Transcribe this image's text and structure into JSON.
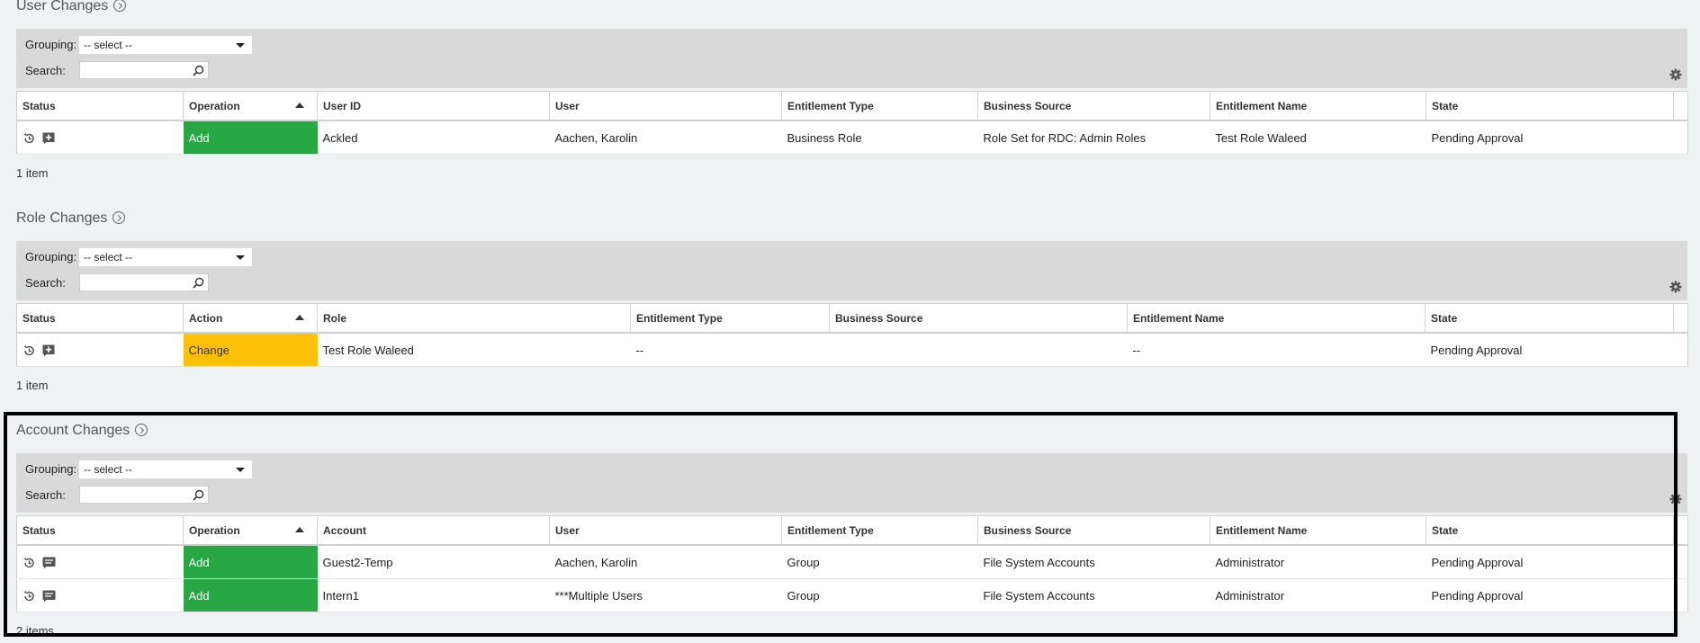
{
  "common": {
    "grouping_label": "Grouping:",
    "search_label": "Search:",
    "select_placeholder": "-- select --"
  },
  "user_changes": {
    "title": "User Changes",
    "columns": [
      "Status",
      "Operation",
      "User ID",
      "User",
      "Entitlement Type",
      "Business Source",
      "Entitlement Name",
      "State"
    ],
    "rows": [
      {
        "operation": "Add",
        "user_id": "Ackled",
        "user": "Aachen, Karolin",
        "entitlement_type": "Business Role",
        "business_source": "Role Set for RDC: Admin Roles",
        "entitlement_name": "Test Role Waleed",
        "state": "Pending Approval"
      }
    ],
    "count": "1 item"
  },
  "role_changes": {
    "title": "Role Changes",
    "columns": [
      "Status",
      "Action",
      "Role",
      "Entitlement Type",
      "Business Source",
      "Entitlement Name",
      "State"
    ],
    "rows": [
      {
        "action": "Change",
        "role": "Test Role Waleed",
        "entitlement_type": "--",
        "business_source": "",
        "entitlement_name": "--",
        "state": "Pending Approval"
      }
    ],
    "count": "1 item"
  },
  "account_changes": {
    "title": "Account Changes",
    "columns": [
      "Status",
      "Operation",
      "Account",
      "User",
      "Entitlement Type",
      "Business Source",
      "Entitlement Name",
      "State"
    ],
    "rows": [
      {
        "operation": "Add",
        "account": "Guest2-Temp",
        "user": "Aachen, Karolin",
        "entitlement_type": "Group",
        "business_source": "File System Accounts",
        "entitlement_name": "Administrator",
        "state": "Pending Approval"
      },
      {
        "operation": "Add",
        "account": "Intern1",
        "user": "***Multiple Users",
        "entitlement_type": "Group",
        "business_source": "File System Accounts",
        "entitlement_name": "Administrator",
        "state": "Pending Approval"
      }
    ],
    "count": "2 items"
  },
  "colors": {
    "add": "#28a745",
    "change": "#ffc107",
    "link": "#2f6fa3",
    "toolbar": "#d9d9d9",
    "background": "#eef2f3"
  }
}
